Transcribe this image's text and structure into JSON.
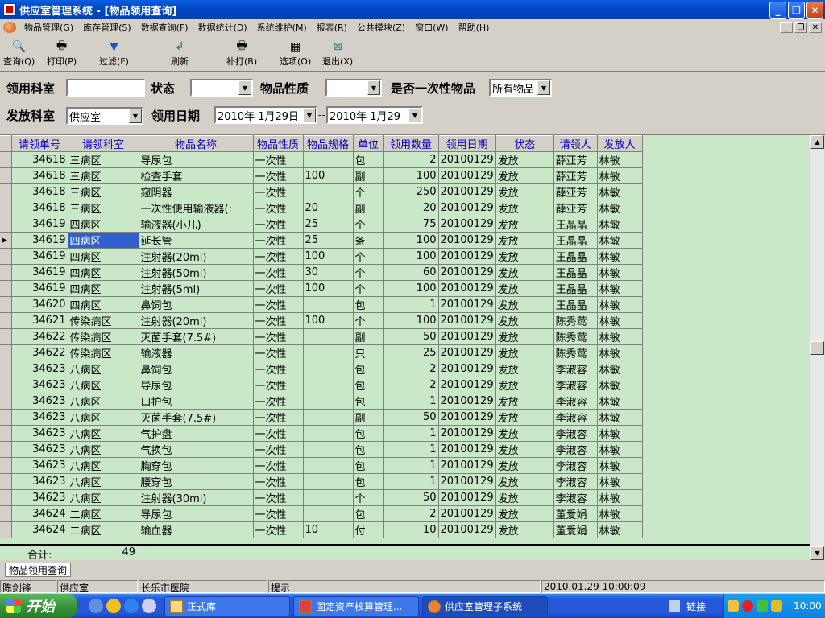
{
  "window": {
    "title": "供应室管理系统 - [物品领用查询]"
  },
  "menu": [
    "物品管理(G)",
    "库存管理(S)",
    "数据查询(F)",
    "数据统计(D)",
    "系统维护(M)",
    "报表(R)",
    "公共模块(Z)",
    "窗口(W)",
    "帮助(H)"
  ],
  "toolbar": {
    "query": "查询(Q)",
    "print": "打印(P)",
    "filter": "过滤(F)",
    "refresh": "刷新",
    "reprint": "补打(B)",
    "options": "选项(O)",
    "exit": "退出(X)"
  },
  "filters": {
    "dept_label": "领用科室",
    "dept_value": "",
    "status_label": "状态",
    "status_value": "",
    "nature_label": "物品性质",
    "nature_value": "",
    "disposable_label": "是否一次性物品",
    "disposable_value": "所有物品",
    "issue_dept_label": "发放科室",
    "issue_dept_value": "供应室",
    "date_label": "领用日期",
    "date_from": "2010年 1月29日",
    "date_sep": "--",
    "date_to": "2010年 1月29"
  },
  "grid": {
    "columns": [
      "请领单号",
      "请领科室",
      "物品名称",
      "物品性质",
      "物品规格",
      "单位",
      "领用数量",
      "领用日期",
      "状态",
      "请领人",
      "发放人"
    ],
    "rows": [
      [
        "34618",
        "三病区",
        "导尿包",
        "一次性",
        "",
        "包",
        "2",
        "20100129",
        "发放",
        "薛亚芳",
        "林敏"
      ],
      [
        "34618",
        "三病区",
        "检查手套",
        "一次性",
        "100",
        "副",
        "100",
        "20100129",
        "发放",
        "薛亚芳",
        "林敏"
      ],
      [
        "34618",
        "三病区",
        "窥阴器",
        "一次性",
        "",
        "个",
        "250",
        "20100129",
        "发放",
        "薛亚芳",
        "林敏"
      ],
      [
        "34618",
        "三病区",
        "一次性使用输液器(:",
        "一次性",
        "20",
        "副",
        "20",
        "20100129",
        "发放",
        "薛亚芳",
        "林敏"
      ],
      [
        "34619",
        "四病区",
        "输液器(小儿)",
        "一次性",
        "25",
        "个",
        "75",
        "20100129",
        "发放",
        "王晶晶",
        "林敏"
      ],
      [
        "34619",
        "四病区",
        "延长管",
        "一次性",
        "25",
        "条",
        "100",
        "20100129",
        "发放",
        "王晶晶",
        "林敏"
      ],
      [
        "34619",
        "四病区",
        "注射器(20ml)",
        "一次性",
        "100",
        "个",
        "100",
        "20100129",
        "发放",
        "王晶晶",
        "林敏"
      ],
      [
        "34619",
        "四病区",
        "注射器(50ml)",
        "一次性",
        "30",
        "个",
        "60",
        "20100129",
        "发放",
        "王晶晶",
        "林敏"
      ],
      [
        "34619",
        "四病区",
        "注射器(5ml)",
        "一次性",
        "100",
        "个",
        "100",
        "20100129",
        "发放",
        "王晶晶",
        "林敏"
      ],
      [
        "34620",
        "四病区",
        "鼻饲包",
        "一次性",
        "",
        "包",
        "1",
        "20100129",
        "发放",
        "王晶晶",
        "林敏"
      ],
      [
        "34621",
        "传染病区",
        "注射器(20ml)",
        "一次性",
        "100",
        "个",
        "100",
        "20100129",
        "发放",
        "陈秀莺",
        "林敏"
      ],
      [
        "34622",
        "传染病区",
        "灭菌手套(7.5#)",
        "一次性",
        "",
        "副",
        "50",
        "20100129",
        "发放",
        "陈秀莺",
        "林敏"
      ],
      [
        "34622",
        "传染病区",
        "输液器",
        "一次性",
        "",
        "只",
        "25",
        "20100129",
        "发放",
        "陈秀莺",
        "林敏"
      ],
      [
        "34623",
        "八病区",
        "鼻饲包",
        "一次性",
        "",
        "包",
        "2",
        "20100129",
        "发放",
        "李淑容",
        "林敏"
      ],
      [
        "34623",
        "八病区",
        "导尿包",
        "一次性",
        "",
        "包",
        "2",
        "20100129",
        "发放",
        "李淑容",
        "林敏"
      ],
      [
        "34623",
        "八病区",
        "口护包",
        "一次性",
        "",
        "包",
        "1",
        "20100129",
        "发放",
        "李淑容",
        "林敏"
      ],
      [
        "34623",
        "八病区",
        "灭菌手套(7.5#)",
        "一次性",
        "",
        "副",
        "50",
        "20100129",
        "发放",
        "李淑容",
        "林敏"
      ],
      [
        "34623",
        "八病区",
        "气护盘",
        "一次性",
        "",
        "包",
        "1",
        "20100129",
        "发放",
        "李淑容",
        "林敏"
      ],
      [
        "34623",
        "八病区",
        "气换包",
        "一次性",
        "",
        "包",
        "1",
        "20100129",
        "发放",
        "李淑容",
        "林敏"
      ],
      [
        "34623",
        "八病区",
        "胸穿包",
        "一次性",
        "",
        "包",
        "1",
        "20100129",
        "发放",
        "李淑容",
        "林敏"
      ],
      [
        "34623",
        "八病区",
        "腰穿包",
        "一次性",
        "",
        "包",
        "1",
        "20100129",
        "发放",
        "李淑容",
        "林敏"
      ],
      [
        "34623",
        "八病区",
        "注射器(30ml)",
        "一次性",
        "",
        "个",
        "50",
        "20100129",
        "发放",
        "李淑容",
        "林敏"
      ],
      [
        "34624",
        "二病区",
        "导尿包",
        "一次性",
        "",
        "包",
        "2",
        "20100129",
        "发放",
        "董爱娟",
        "林敏"
      ],
      [
        "34624",
        "二病区",
        "输血器",
        "一次性",
        "10",
        "付",
        "10",
        "20100129",
        "发放",
        "董爱娟",
        "林敏"
      ]
    ],
    "selected_row": 5,
    "sum_label": "合计:",
    "sum_value": "49"
  },
  "tab": "物品领用查询",
  "status": {
    "user": "陈剑锋",
    "dept": "供应室",
    "hospital": "长乐市医院",
    "hint": "提示",
    "datetime": "2010.01.29 10:00:09"
  },
  "taskbar": {
    "start": "开始",
    "tasks": [
      "正式库",
      "固定资产核算管理...",
      "供应室管理子系统"
    ],
    "links": "链接",
    "clock": "10:00"
  }
}
